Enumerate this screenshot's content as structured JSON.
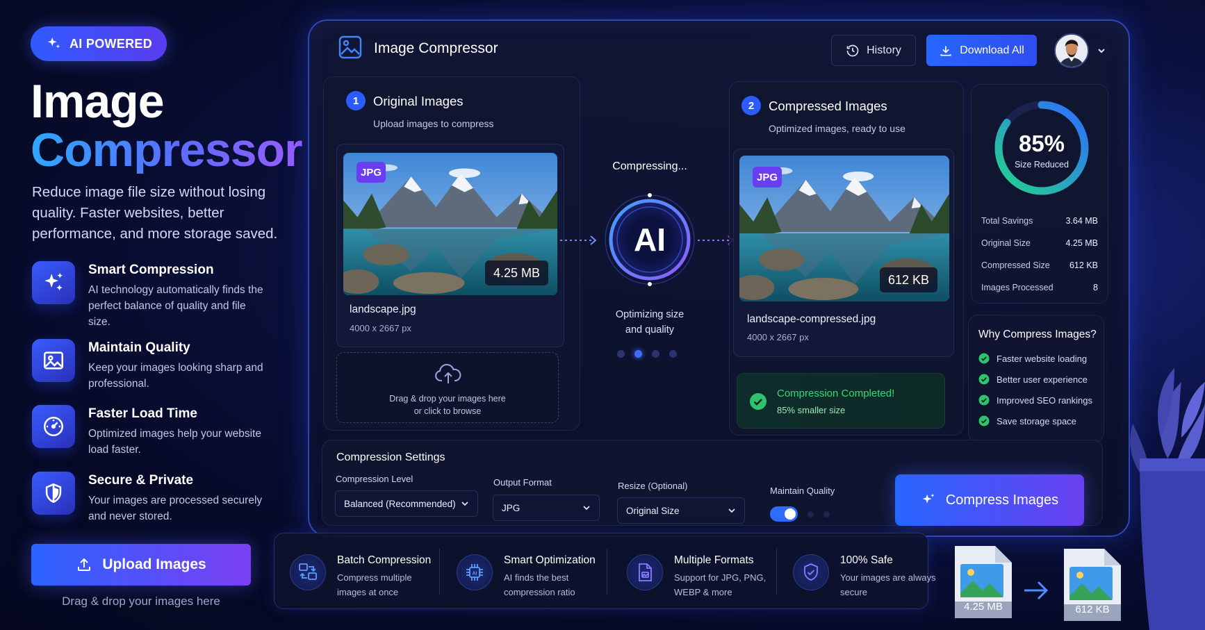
{
  "hero": {
    "badge": "AI POWERED",
    "title_line1": "Image",
    "title_line2": "Compressor",
    "description": "Reduce image file size without losing quality. Faster websites, better performance, and more storage saved.",
    "features": [
      {
        "title": "Smart Compression",
        "desc": "AI technology automatically finds the perfect balance of quality and file size.",
        "icon": "sparkles-icon"
      },
      {
        "title": "Maintain Quality",
        "desc": "Keep your images looking sharp and professional.",
        "icon": "image-icon"
      },
      {
        "title": "Faster Load Time",
        "desc": "Optimized images help your website load faster.",
        "icon": "speedometer-icon"
      },
      {
        "title": "Secure & Private",
        "desc": "Your images are processed securely and never stored.",
        "icon": "shield-icon"
      }
    ],
    "upload_button": "Upload Images",
    "upload_hint": "Drag & drop your images here"
  },
  "app": {
    "title": "Image Compressor",
    "history_button": "History",
    "download_all_button": "Download All",
    "original": {
      "step": "1",
      "title": "Original Images",
      "subtitle": "Upload images to compress",
      "format_tag": "JPG",
      "size": "4.25 MB",
      "filename": "landscape.jpg",
      "dimensions": "4000 x 2667 px",
      "drop_line1": "Drag & drop your images here",
      "drop_line2": "or click to browse"
    },
    "process": {
      "status": "Compressing...",
      "ai_label": "AI",
      "caption_line1": "Optimizing size",
      "caption_line2": "and quality"
    },
    "compressed": {
      "step": "2",
      "title": "Compressed Images",
      "subtitle": "Optimized images, ready to use",
      "format_tag": "JPG",
      "size": "612 KB",
      "filename": "landscape-compressed.jpg",
      "dimensions": "4000 x 2667 px",
      "done_title": "Compression Completed!",
      "done_sub": "85% smaller size"
    },
    "stats": {
      "percent": "85%",
      "percent_value": 85,
      "percent_label": "Size Reduced",
      "rows": [
        {
          "label": "Total Savings",
          "value": "3.64 MB"
        },
        {
          "label": "Original Size",
          "value": "4.25 MB"
        },
        {
          "label": "Compressed Size",
          "value": "612 KB"
        },
        {
          "label": "Images Processed",
          "value": "8"
        }
      ]
    },
    "why": {
      "title": "Why Compress Images?",
      "items": [
        "Faster website loading",
        "Better user experience",
        "Improved SEO rankings",
        "Save storage space"
      ]
    },
    "settings": {
      "title": "Compression Settings",
      "level_label": "Compression Level",
      "level_value": "Balanced (Recommended)",
      "format_label": "Output Format",
      "format_value": "JPG",
      "resize_label": "Resize (Optional)",
      "resize_value": "Original Size",
      "quality_label": "Maintain Quality",
      "quality_on": true,
      "compress_button": "Compress Images"
    }
  },
  "strip": [
    {
      "title": "Batch Compression",
      "desc": "Compress multiple images at once",
      "icon": "batch-images-icon"
    },
    {
      "title": "Smart Optimization",
      "desc": "AI finds the best compression ratio",
      "icon": "ai-chip-icon"
    },
    {
      "title": "Multiple Formats",
      "desc": "Support for JPG, PNG, WEBP & more",
      "icon": "file-formats-icon"
    },
    {
      "title": "100% Safe",
      "desc": "Your images are always secure",
      "icon": "shield-check-icon"
    }
  ],
  "files": {
    "before": "4.25 MB",
    "after": "612 KB"
  },
  "colors": {
    "accent": "#2a5cff",
    "purple": "#7a3ff2",
    "success": "#34d97a",
    "background": "#060a26"
  }
}
